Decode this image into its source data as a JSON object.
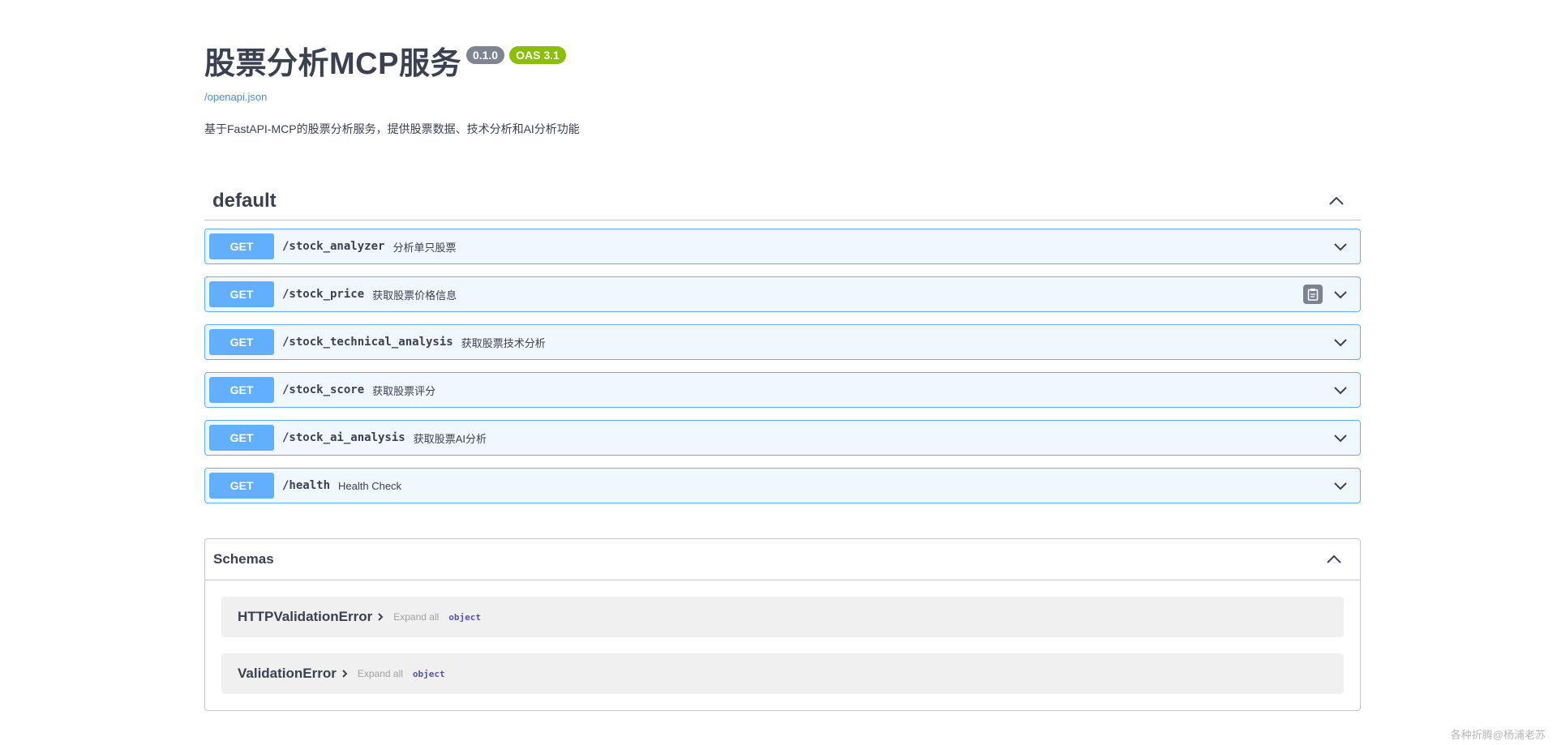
{
  "info": {
    "title": "股票分析MCP服务",
    "version": "0.1.0",
    "oas": "OAS 3.1",
    "spec_link": "/openapi.json",
    "description": "基于FastAPI-MCP的股票分析服务，提供股票数据、技术分析和AI分析功能"
  },
  "tag": {
    "name": "default"
  },
  "operations": [
    {
      "method": "GET",
      "path": "/stock_analyzer",
      "summary": "分析单只股票"
    },
    {
      "method": "GET",
      "path": "/stock_price",
      "summary": "获取股票价格信息"
    },
    {
      "method": "GET",
      "path": "/stock_technical_analysis",
      "summary": "获取股票技术分析"
    },
    {
      "method": "GET",
      "path": "/stock_score",
      "summary": "获取股票评分"
    },
    {
      "method": "GET",
      "path": "/stock_ai_analysis",
      "summary": "获取股票AI分析"
    },
    {
      "method": "GET",
      "path": "/health",
      "summary": "Health Check"
    }
  ],
  "schemas": {
    "title": "Schemas",
    "models": [
      {
        "name": "HTTPValidationError",
        "expand": "Expand all",
        "type": "object"
      },
      {
        "name": "ValidationError",
        "expand": "Expand all",
        "type": "object"
      }
    ]
  },
  "watermark": "各种折腾@杨浦老苏",
  "colors": {
    "get": "#61affe",
    "oas": "#89bf04",
    "version": "#7d8492",
    "link": "#4990e2"
  }
}
